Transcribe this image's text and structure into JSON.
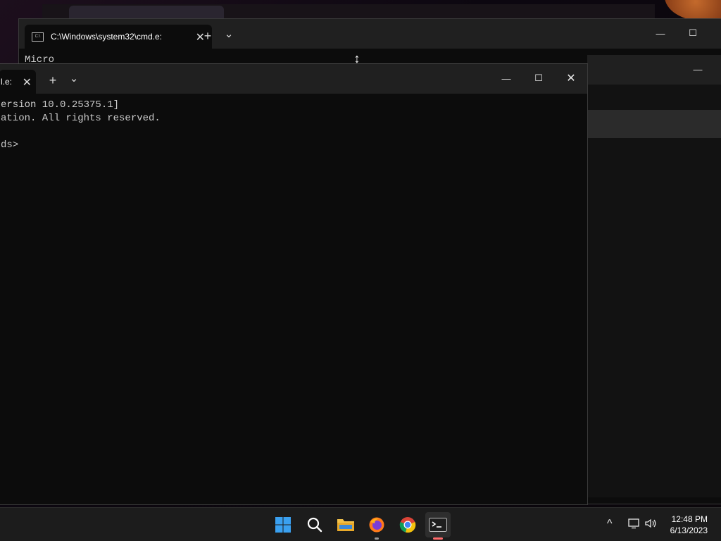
{
  "back_window": {
    "tab_title": "C:\\Windows\\system32\\cmd.e:",
    "tab_close": "✕",
    "new_tab": "+",
    "dropdown": "⌄",
    "minimize": "—",
    "maximize": "☐",
    "console_text": "Micro"
  },
  "front_window": {
    "tab_title": "l.e:",
    "tab_close": "✕",
    "new_tab": "+",
    "dropdown": "⌄",
    "minimize": "—",
    "maximize": "☐",
    "close": "✕",
    "console_lines": [
      "ersion 10.0.25375.1]",
      "ation. All rights reserved.",
      "",
      "ds>"
    ]
  },
  "third_window": {
    "minimize": "—"
  },
  "taskbar": {
    "icons": [
      "start-icon",
      "search-icon",
      "file-explorer-icon",
      "firefox-icon",
      "chrome-icon",
      "terminal-icon"
    ],
    "tray_chevron": "^",
    "clock_time": "12:48 PM",
    "clock_date": "6/13/2023"
  },
  "colors": {
    "terminal_bg": "#0c0c0c",
    "titlebar_bg": "#202020",
    "taskbar_bg": "#1c1c1c",
    "terminal_text": "#cccccc"
  }
}
